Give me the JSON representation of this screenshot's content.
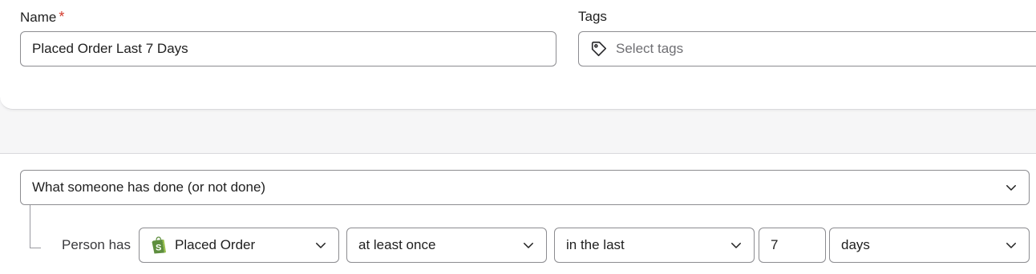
{
  "details": {
    "name_label": "Name",
    "required_mark": "*",
    "name_value": "Placed Order Last 7 Days",
    "tags_label": "Tags",
    "tags_placeholder": "Select tags"
  },
  "condition": {
    "type_value": "What someone has done (or not done)",
    "person_has_label": "Person has",
    "metric_value": "Placed Order",
    "frequency_value": "at least once",
    "timeframe_value": "in the last",
    "amount_value": "7",
    "unit_value": "days"
  },
  "icons": {
    "tag": "tag-icon",
    "chevron": "chevron-down-icon",
    "metric_source": "shopify-icon"
  },
  "colors": {
    "required": "#d33a2c",
    "shopify_green": "#5e8e3e"
  }
}
